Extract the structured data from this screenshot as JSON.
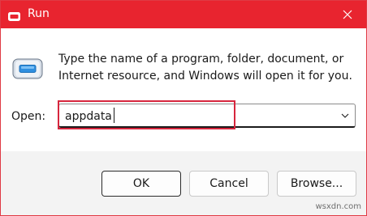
{
  "window": {
    "title": "Run",
    "title_bar_color": "#e8242f",
    "icons": {
      "title": "run-app-icon",
      "close": "close-icon",
      "main": "run-app-icon",
      "dropdown": "chevron-down-icon"
    }
  },
  "content": {
    "description": "Type the name of a program, folder, document, or Internet resource, and Windows will open it for you."
  },
  "open_field": {
    "label": "Open:",
    "value": "appdata"
  },
  "buttons": {
    "ok": "OK",
    "cancel": "Cancel",
    "browse": "Browse..."
  },
  "annotation": {
    "highlight_color": "#d7263d"
  },
  "watermark": "wsxdn.com"
}
